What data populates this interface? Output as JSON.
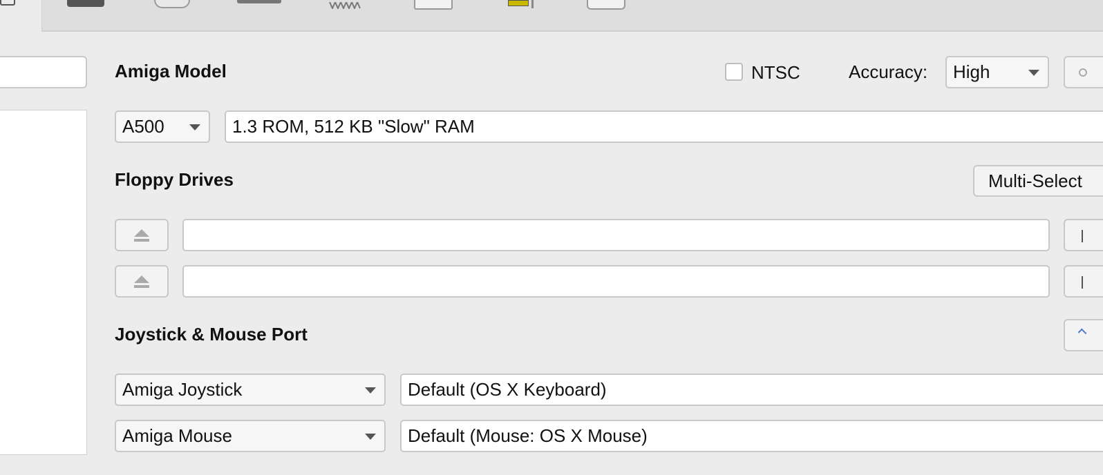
{
  "toolbar": {
    "icons": [
      "floppy-disk-icon",
      "cd-disc-icon",
      "hard-drive-icon",
      "memory-icon",
      "keyboard-icon",
      "chip-icon",
      "monitor-icon"
    ]
  },
  "amiga_model": {
    "title": "Amiga Model",
    "ntsc_label": "NTSC",
    "ntsc_checked": false,
    "accuracy_label": "Accuracy:",
    "accuracy_value": "High",
    "model_value": "A500",
    "model_description": "1.3 ROM, 512 KB \"Slow\" RAM"
  },
  "floppy": {
    "title": "Floppy Drives",
    "multi_select_label": "Multi-Select",
    "drive_1_path": "",
    "drive_2_path": ""
  },
  "ports": {
    "title": "Joystick & Mouse Port",
    "port_1_type": "Amiga Joystick",
    "port_1_device": "Default (OS X Keyboard)",
    "port_2_type": "Amiga Mouse",
    "port_2_device": "Default (Mouse: OS X Mouse)"
  },
  "colors": {
    "background": "#ececec",
    "toolbar": "#dedede",
    "field_border": "#c8c8c8"
  }
}
